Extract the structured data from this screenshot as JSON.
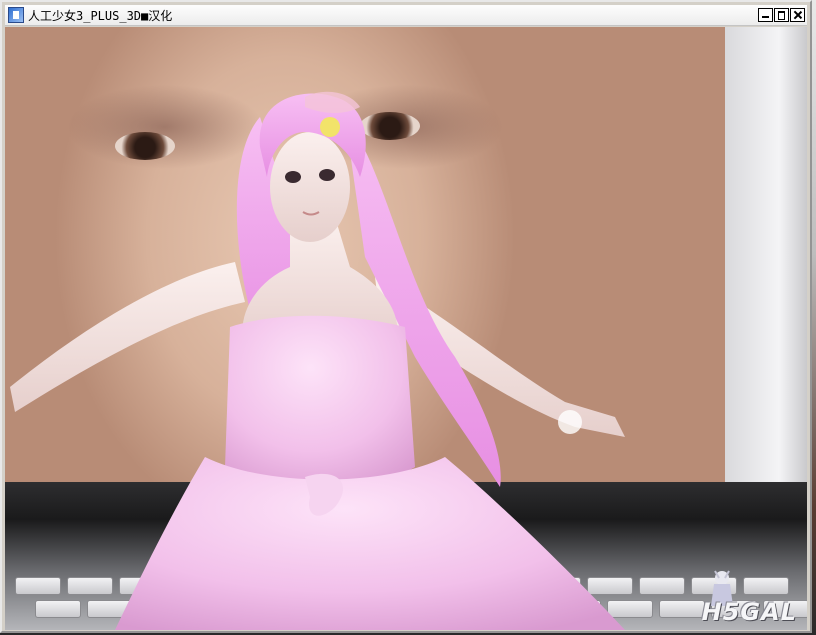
{
  "window": {
    "title": "人工少女3_PLUS_3D■汉化",
    "controls": {
      "minimize_icon": "minimize-icon",
      "maximize_icon": "maximize-icon",
      "close_icon": "close-icon"
    }
  },
  "scene": {
    "watermark": "H5GAL",
    "colors": {
      "hair": "#f0a6ec",
      "dress": "#f6cbef",
      "skin": "#f4e4e0",
      "background_photo": "#d7b19a",
      "laptop": "#1e1e20"
    }
  }
}
